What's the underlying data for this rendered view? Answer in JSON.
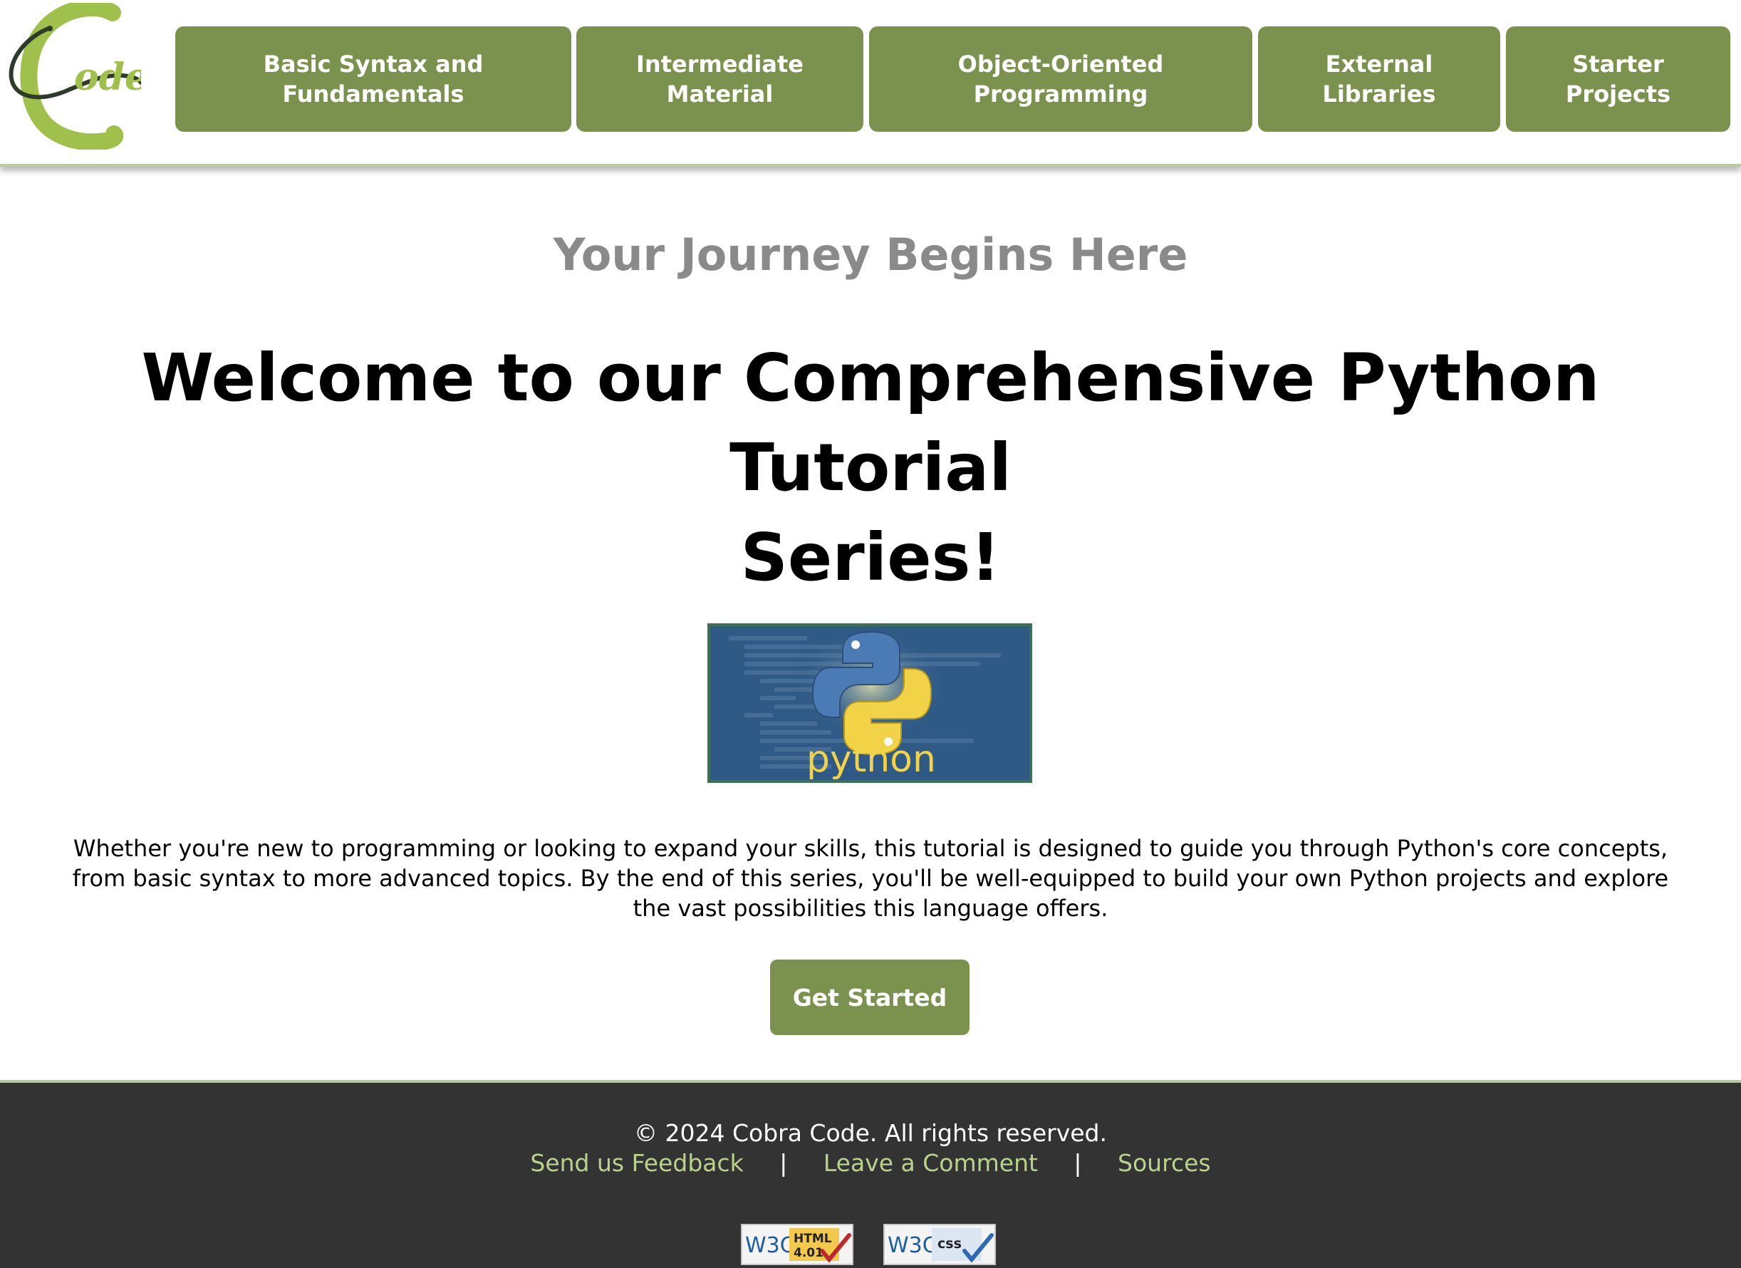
{
  "header": {
    "logo": {
      "text": "ode",
      "icon": "cobra-code-logo"
    },
    "nav": [
      {
        "line1": "Basic Syntax and",
        "line2": "Fundamentals"
      },
      {
        "line1": "Intermediate",
        "line2": "Material"
      },
      {
        "line1": "Object-Oriented",
        "line2": "Programming"
      },
      {
        "line1": "External",
        "line2": "Libraries"
      },
      {
        "line1": "Starter",
        "line2": "Projects"
      }
    ]
  },
  "main": {
    "subtitle": "Your Journey Begins Here",
    "headline_line1": "Welcome to our Comprehensive Python Tutorial",
    "headline_line2": "Series!",
    "hero_image": {
      "icon": "python-logo",
      "caption": "python"
    },
    "intro": "Whether you're new to programming or looking to expand your skills, this tutorial is designed to guide you through Python's core concepts, from basic syntax to more advanced topics. By the end of this series, you'll be well-equipped to build your own Python projects and explore the vast possibilities this language offers.",
    "cta_label": "Get Started"
  },
  "footer": {
    "copyright": "© 2024 Cobra Code. All rights reserved.",
    "links": [
      "Send us Feedback",
      "Leave a Comment",
      "Sources"
    ],
    "separator": "|",
    "badges": [
      {
        "w3c": "W3C",
        "label_top": "HTML",
        "label_bottom": "4.01",
        "icon": "w3c-html-badge"
      },
      {
        "w3c": "W3C",
        "label_top": "css",
        "label_bottom": "",
        "icon": "w3c-css-badge"
      }
    ]
  },
  "colors": {
    "accent_green": "#7a924d",
    "logo_green": "#9fc14b",
    "link_green": "#b9d38c",
    "footer_bg": "#333333",
    "subtitle_gray": "#8a8a8a"
  }
}
